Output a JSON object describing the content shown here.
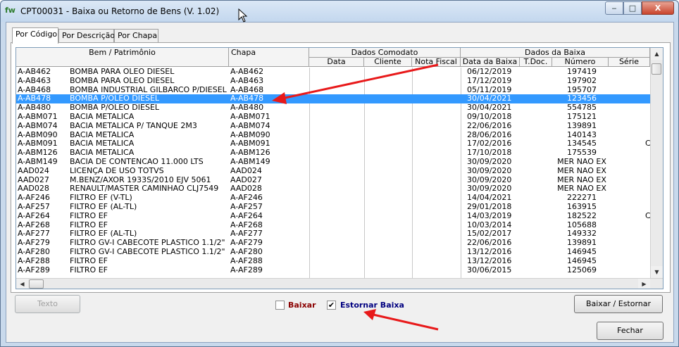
{
  "window": {
    "title": "CPT00031 - Baixa ou Retorno de Bens  (V. 1.02)",
    "app_icon": "fw",
    "minimize_label": "‒",
    "maximize_label": "□",
    "close_label": "X"
  },
  "tabs": [
    {
      "label": "Por Código",
      "active": true
    },
    {
      "label": "Por Descrição",
      "active": false
    },
    {
      "label": "Por Chapa",
      "active": false
    }
  ],
  "grid": {
    "headers": {
      "bem": "Bem / Patrimônio",
      "chapa": "Chapa",
      "dados_comodato": "Dados Comodato",
      "data": "Data",
      "cliente": "Cliente",
      "nota_fiscal": "Nota Fiscal",
      "dados_baixa": "Dados da Baixa",
      "data_baixa": "Data da Baixa",
      "tdoc": "T.Doc.",
      "numero": "Número",
      "serie": "Série"
    },
    "rows": [
      {
        "codigo": "A-AB462",
        "descricao": "BOMBA PARA OLEO DIESEL",
        "chapa": "A-AB462",
        "data_baixa": "06/12/2019",
        "numero": "197419",
        "serie": "",
        "selected": false
      },
      {
        "codigo": "A-AB463",
        "descricao": "BOMBA PARA OLEO DIESEL",
        "chapa": "A-AB463",
        "data_baixa": "17/12/2019",
        "numero": "197902",
        "serie": "",
        "selected": false
      },
      {
        "codigo": "A-AB468",
        "descricao": "BOMBA INDUSTRIAL GILBARCO P/DIESEL",
        "chapa": "A-AB468",
        "data_baixa": "05/11/2019",
        "numero": "195707",
        "serie": "",
        "selected": false
      },
      {
        "codigo": "A-AB478",
        "descricao": "BOMBA P/OLEO DIESEL",
        "chapa": "A-AB478",
        "data_baixa": "30/04/2021",
        "numero": "123456",
        "serie": "",
        "selected": true
      },
      {
        "codigo": "A-AB480",
        "descricao": "BOMBA P/OLEO DIESEL",
        "chapa": "A-AB480",
        "data_baixa": "30/04/2021",
        "numero": "554785",
        "serie": "",
        "selected": false
      },
      {
        "codigo": "A-ABM071",
        "descricao": "BACIA METALICA",
        "chapa": "A-ABM071",
        "data_baixa": "09/10/2018",
        "numero": "175121",
        "serie": "",
        "selected": false
      },
      {
        "codigo": "A-ABM074",
        "descricao": "BACIA METALICA P/ TANQUE 2M3",
        "chapa": "A-ABM074",
        "data_baixa": "22/06/2016",
        "numero": "139891",
        "serie": "",
        "selected": false
      },
      {
        "codigo": "A-ABM090",
        "descricao": "BACIA METALICA",
        "chapa": "A-ABM090",
        "data_baixa": "28/06/2016",
        "numero": "140143",
        "serie": "",
        "selected": false
      },
      {
        "codigo": "A-ABM091",
        "descricao": "BACIA METALICA",
        "chapa": "A-ABM091",
        "data_baixa": "17/02/2016",
        "numero": "134545",
        "serie": "C",
        "selected": false
      },
      {
        "codigo": "A-ABM126",
        "descricao": "BACIA METALICA",
        "chapa": "A-ABM126",
        "data_baixa": "17/10/2018",
        "numero": "175539",
        "serie": "",
        "selected": false
      },
      {
        "codigo": "A-ABM149",
        "descricao": "BACIA DE CONTENCAO 11.000 LTS",
        "chapa": "A-ABM149",
        "data_baixa": "30/09/2020",
        "numero": "MER NAO EX",
        "serie": "",
        "selected": false
      },
      {
        "codigo": "AAD024",
        "descricao": "LICENÇA DE USO TOTVS",
        "chapa": "AAD024",
        "data_baixa": "30/09/2020",
        "numero": "MER NAO EX",
        "serie": "",
        "selected": false
      },
      {
        "codigo": "AAD027",
        "descricao": "M.BENZ/AXOR 1933S/2010 EJV 5061",
        "chapa": "AAD027",
        "data_baixa": "30/09/2020",
        "numero": "MER NAO EX",
        "serie": "",
        "selected": false
      },
      {
        "codigo": "AAD028",
        "descricao": "RENAULT/MASTER CAMINHAO CLJ7549",
        "chapa": "AAD028",
        "data_baixa": "30/09/2020",
        "numero": "MER NAO EX",
        "serie": "",
        "selected": false
      },
      {
        "codigo": "A-AF246",
        "descricao": "FILTRO EF (V-TL)",
        "chapa": "A-AF246",
        "data_baixa": "14/04/2021",
        "numero": "222271",
        "serie": "",
        "selected": false
      },
      {
        "codigo": "A-AF257",
        "descricao": "FILTRO EF (AL-TL)",
        "chapa": "A-AF257",
        "data_baixa": "29/01/2018",
        "numero": "163915",
        "serie": "",
        "selected": false
      },
      {
        "codigo": "A-AF264",
        "descricao": "FILTRO EF",
        "chapa": "A-AF264",
        "data_baixa": "14/03/2019",
        "numero": "182522",
        "serie": "C",
        "selected": false
      },
      {
        "codigo": "A-AF268",
        "descricao": "FILTRO EF",
        "chapa": "A-AF268",
        "data_baixa": "10/03/2014",
        "numero": "105688",
        "serie": "",
        "selected": false
      },
      {
        "codigo": "A-AF277",
        "descricao": "FILTRO EF (AL-TL)",
        "chapa": "A-AF277",
        "data_baixa": "15/02/2017",
        "numero": "149332",
        "serie": "",
        "selected": false
      },
      {
        "codigo": "A-AF279",
        "descricao": "FILTRO GV-I CABECOTE PLASTICO 1.1/2\"",
        "chapa": "A-AF279",
        "data_baixa": "22/06/2016",
        "numero": "139891",
        "serie": "",
        "selected": false
      },
      {
        "codigo": "A-AF280",
        "descricao": "FILTRO GV-I CABECOTE PLASTICO 1.1/2\"",
        "chapa": "A-AF280",
        "data_baixa": "13/12/2016",
        "numero": "146945",
        "serie": "",
        "selected": false
      },
      {
        "codigo": "A-AF288",
        "descricao": "FILTRO EF",
        "chapa": "A-AF288",
        "data_baixa": "13/12/2016",
        "numero": "146945",
        "serie": "",
        "selected": false
      },
      {
        "codigo": "A-AF289",
        "descricao": "FILTRO EF",
        "chapa": "A-AF289",
        "data_baixa": "30/06/2015",
        "numero": "125069",
        "serie": "",
        "selected": false
      }
    ]
  },
  "footer": {
    "texto_button": "Texto",
    "baixar_label": "Baixar",
    "baixar_checked": false,
    "estornar_label": "Estornar Baixa",
    "estornar_checked": true,
    "check_mark": "✔",
    "baixar_estornar_button": "Baixar / Estornar",
    "fechar_button": "Fechar"
  },
  "colors": {
    "selection": "#3399ff",
    "baixar_label": "#8b0000",
    "estornar_label": "#000080",
    "annotation_arrow": "#e8191a"
  }
}
